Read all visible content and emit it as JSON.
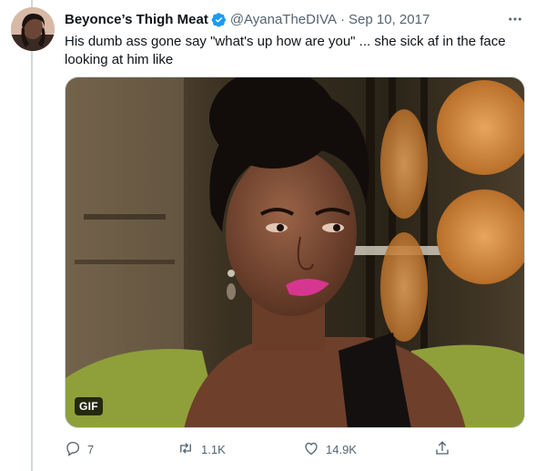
{
  "tweet": {
    "display_name": "Beyonce’s Thigh Meat",
    "handle": "@AyanaTheDIVA",
    "separator": "·",
    "date": "Sep 10, 2017",
    "text": "His dumb ass gone say \"what's up how are you\" ... she sick af in the face looking at him like",
    "media": {
      "badge": "GIF",
      "type": "animated-gif"
    },
    "actions": {
      "reply": {
        "icon": "reply-icon",
        "count": "7"
      },
      "retweet": {
        "icon": "retweet-icon",
        "count": "1.1K"
      },
      "like": {
        "icon": "heart-icon",
        "count": "14.9K"
      },
      "share": {
        "icon": "share-icon"
      }
    },
    "more_icon": "more-options-icon"
  },
  "colors": {
    "text_primary": "#0f1419",
    "text_secondary": "#536471",
    "verified_blue": "#1d9bf0",
    "thread_line": "#cfd9de"
  }
}
